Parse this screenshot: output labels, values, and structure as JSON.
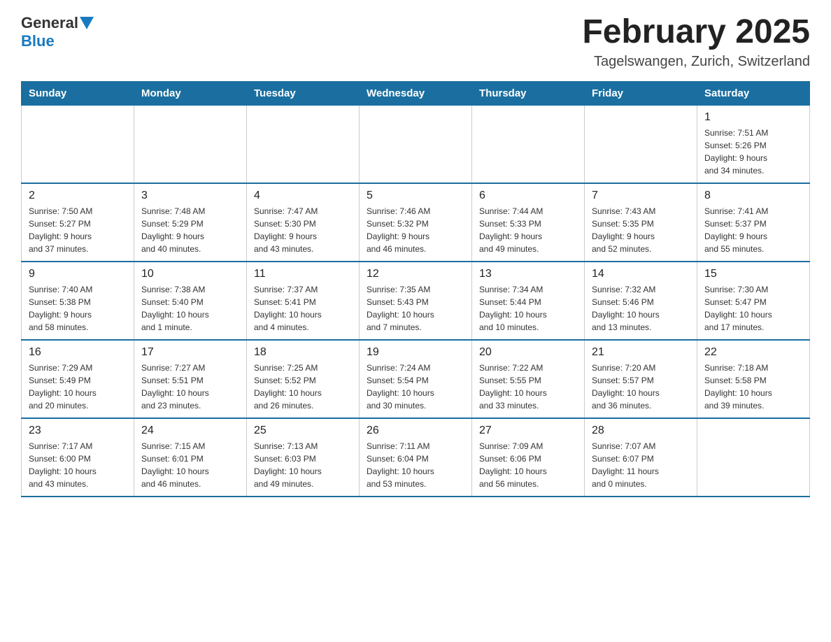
{
  "header": {
    "logo": {
      "part1": "General",
      "part2": "Blue"
    },
    "title": "February 2025",
    "location": "Tagelswangen, Zurich, Switzerland"
  },
  "days_of_week": [
    "Sunday",
    "Monday",
    "Tuesday",
    "Wednesday",
    "Thursday",
    "Friday",
    "Saturday"
  ],
  "weeks": [
    [
      {
        "day": "",
        "info": ""
      },
      {
        "day": "",
        "info": ""
      },
      {
        "day": "",
        "info": ""
      },
      {
        "day": "",
        "info": ""
      },
      {
        "day": "",
        "info": ""
      },
      {
        "day": "",
        "info": ""
      },
      {
        "day": "1",
        "info": "Sunrise: 7:51 AM\nSunset: 5:26 PM\nDaylight: 9 hours\nand 34 minutes."
      }
    ],
    [
      {
        "day": "2",
        "info": "Sunrise: 7:50 AM\nSunset: 5:27 PM\nDaylight: 9 hours\nand 37 minutes."
      },
      {
        "day": "3",
        "info": "Sunrise: 7:48 AM\nSunset: 5:29 PM\nDaylight: 9 hours\nand 40 minutes."
      },
      {
        "day": "4",
        "info": "Sunrise: 7:47 AM\nSunset: 5:30 PM\nDaylight: 9 hours\nand 43 minutes."
      },
      {
        "day": "5",
        "info": "Sunrise: 7:46 AM\nSunset: 5:32 PM\nDaylight: 9 hours\nand 46 minutes."
      },
      {
        "day": "6",
        "info": "Sunrise: 7:44 AM\nSunset: 5:33 PM\nDaylight: 9 hours\nand 49 minutes."
      },
      {
        "day": "7",
        "info": "Sunrise: 7:43 AM\nSunset: 5:35 PM\nDaylight: 9 hours\nand 52 minutes."
      },
      {
        "day": "8",
        "info": "Sunrise: 7:41 AM\nSunset: 5:37 PM\nDaylight: 9 hours\nand 55 minutes."
      }
    ],
    [
      {
        "day": "9",
        "info": "Sunrise: 7:40 AM\nSunset: 5:38 PM\nDaylight: 9 hours\nand 58 minutes."
      },
      {
        "day": "10",
        "info": "Sunrise: 7:38 AM\nSunset: 5:40 PM\nDaylight: 10 hours\nand 1 minute."
      },
      {
        "day": "11",
        "info": "Sunrise: 7:37 AM\nSunset: 5:41 PM\nDaylight: 10 hours\nand 4 minutes."
      },
      {
        "day": "12",
        "info": "Sunrise: 7:35 AM\nSunset: 5:43 PM\nDaylight: 10 hours\nand 7 minutes."
      },
      {
        "day": "13",
        "info": "Sunrise: 7:34 AM\nSunset: 5:44 PM\nDaylight: 10 hours\nand 10 minutes."
      },
      {
        "day": "14",
        "info": "Sunrise: 7:32 AM\nSunset: 5:46 PM\nDaylight: 10 hours\nand 13 minutes."
      },
      {
        "day": "15",
        "info": "Sunrise: 7:30 AM\nSunset: 5:47 PM\nDaylight: 10 hours\nand 17 minutes."
      }
    ],
    [
      {
        "day": "16",
        "info": "Sunrise: 7:29 AM\nSunset: 5:49 PM\nDaylight: 10 hours\nand 20 minutes."
      },
      {
        "day": "17",
        "info": "Sunrise: 7:27 AM\nSunset: 5:51 PM\nDaylight: 10 hours\nand 23 minutes."
      },
      {
        "day": "18",
        "info": "Sunrise: 7:25 AM\nSunset: 5:52 PM\nDaylight: 10 hours\nand 26 minutes."
      },
      {
        "day": "19",
        "info": "Sunrise: 7:24 AM\nSunset: 5:54 PM\nDaylight: 10 hours\nand 30 minutes."
      },
      {
        "day": "20",
        "info": "Sunrise: 7:22 AM\nSunset: 5:55 PM\nDaylight: 10 hours\nand 33 minutes."
      },
      {
        "day": "21",
        "info": "Sunrise: 7:20 AM\nSunset: 5:57 PM\nDaylight: 10 hours\nand 36 minutes."
      },
      {
        "day": "22",
        "info": "Sunrise: 7:18 AM\nSunset: 5:58 PM\nDaylight: 10 hours\nand 39 minutes."
      }
    ],
    [
      {
        "day": "23",
        "info": "Sunrise: 7:17 AM\nSunset: 6:00 PM\nDaylight: 10 hours\nand 43 minutes."
      },
      {
        "day": "24",
        "info": "Sunrise: 7:15 AM\nSunset: 6:01 PM\nDaylight: 10 hours\nand 46 minutes."
      },
      {
        "day": "25",
        "info": "Sunrise: 7:13 AM\nSunset: 6:03 PM\nDaylight: 10 hours\nand 49 minutes."
      },
      {
        "day": "26",
        "info": "Sunrise: 7:11 AM\nSunset: 6:04 PM\nDaylight: 10 hours\nand 53 minutes."
      },
      {
        "day": "27",
        "info": "Sunrise: 7:09 AM\nSunset: 6:06 PM\nDaylight: 10 hours\nand 56 minutes."
      },
      {
        "day": "28",
        "info": "Sunrise: 7:07 AM\nSunset: 6:07 PM\nDaylight: 11 hours\nand 0 minutes."
      },
      {
        "day": "",
        "info": ""
      }
    ]
  ]
}
